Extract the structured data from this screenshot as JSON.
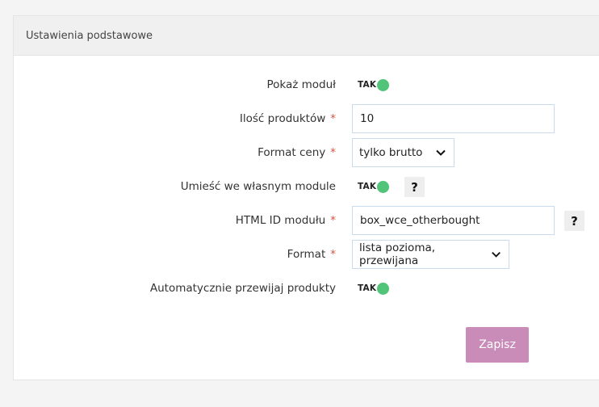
{
  "panel": {
    "title": "Ustawienia podstawowe"
  },
  "form": {
    "show_module": {
      "label": "Pokaż moduł",
      "toggle": "TAK"
    },
    "product_count": {
      "label": "Ilość produktów",
      "required": "*",
      "value": "10"
    },
    "price_format": {
      "label": "Format ceny",
      "required": "*",
      "value": "tylko brutto"
    },
    "own_module": {
      "label": "Umieść we własnym module",
      "toggle": "TAK",
      "help": "?"
    },
    "html_id": {
      "label": "HTML ID modułu",
      "required": "*",
      "value": "box_wce_otherbought",
      "help": "?"
    },
    "format": {
      "label": "Format",
      "required": "*",
      "value": "lista pozioma, przewijana"
    },
    "auto_scroll": {
      "label": "Automatycznie przewijaj produkty",
      "toggle": "TAK"
    }
  },
  "actions": {
    "save_label": "Zapisz"
  },
  "colors": {
    "toggle_on": "#52c47a",
    "save_button": "#c98bb8",
    "required": "#e0533b",
    "input_border": "#c9dcef"
  }
}
